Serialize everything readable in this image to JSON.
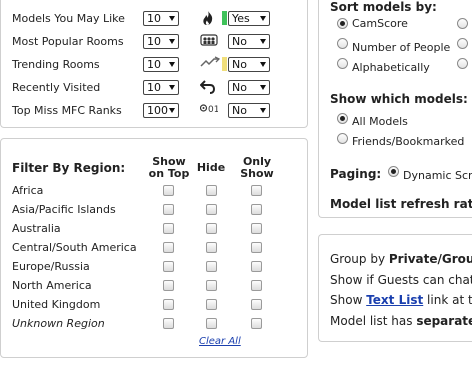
{
  "top_rows": [
    {
      "label": "Models You May Like",
      "count": "10",
      "icon": "fire-icon",
      "mode": "Yes",
      "chip": "#3fc25a"
    },
    {
      "label": "Most Popular Rooms",
      "count": "10",
      "icon": "crowd-icon",
      "mode": "No",
      "chip": ""
    },
    {
      "label": "Trending Rooms",
      "count": "10",
      "icon": "trend-icon",
      "mode": "No",
      "chip": "#f1df7b"
    },
    {
      "label": "Recently Visited",
      "count": "10",
      "icon": "return-arrow-icon",
      "mode": "No",
      "chip": ""
    },
    {
      "label": "Top Miss MFC Ranks",
      "count": "100",
      "icon": "ranks-icon",
      "mode": "No",
      "chip": ""
    }
  ],
  "region": {
    "title": "Filter By Region:",
    "columns": [
      "Show\non Top",
      "Hide",
      "Only\nShow"
    ],
    "regions": [
      "Africa",
      "Asia/Pacific Islands",
      "Australia",
      "Central/South America",
      "Europe/Russia",
      "North America",
      "United Kingdom",
      "Unknown Region"
    ],
    "clear_all": "Clear All"
  },
  "sort": {
    "title": "Sort models by:",
    "options": [
      {
        "label": "CamScore",
        "selected": true
      },
      {
        "label": "Number of People",
        "selected": false
      },
      {
        "label": "Alphabetically",
        "selected": false
      }
    ]
  },
  "show_models": {
    "title": "Show which models:",
    "options": [
      {
        "label": "All Models",
        "selected": true
      },
      {
        "label": "Friends/Bookmarked",
        "selected": false
      }
    ]
  },
  "paging": {
    "label": "Paging:",
    "option": "Dynamic Scro"
  },
  "refresh": {
    "label": "Model list refresh rate:"
  },
  "group": {
    "line1_prefix": "Group by ",
    "line1_bold": "Private/Group",
    "line2": "Show if Guests can chat?",
    "line3_prefix": "Show ",
    "line3_link": "Text List",
    "line3_suffix": " link at the",
    "line4_prefix": "Model list has ",
    "line4_bold": "separate s"
  },
  "colors": {
    "link": "#1a3fae",
    "yes_chip": "#3fc25a",
    "trend_chip": "#f1df7b"
  }
}
